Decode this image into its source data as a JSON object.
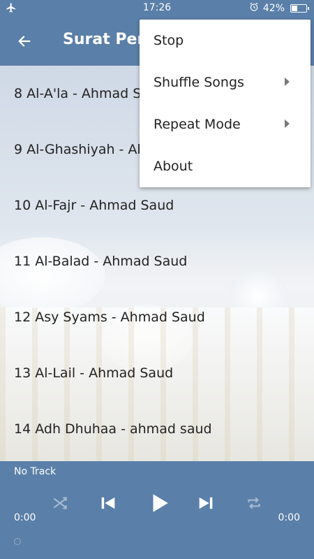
{
  "status_bar": {
    "time": "17:26",
    "battery": "42%",
    "battery_level": 0.42,
    "left_icon": "airplane-icon",
    "alarm_icon": "alarm-clock-icon"
  },
  "toolbar": {
    "title": "Surat Pend",
    "back_icon": "arrow-left-icon"
  },
  "tracks": [
    "8 Al-A'la - Ahmad Sau",
    "9 Al-Ghashiyah - Ahm",
    "10 Al-Fajr - Ahmad Saud",
    "11 Al-Balad - Ahmad Saud",
    "12 Asy Syams - Ahmad Saud",
    "13 Al-Lail - Ahmad Saud",
    "14 Adh Dhuhaa - ahmad saud"
  ],
  "player": {
    "track": "No Track",
    "elapsed": "0:00",
    "duration": "0:00",
    "icons": [
      "shuffle-icon",
      "skip-previous-icon",
      "play-icon",
      "skip-next-icon",
      "repeat-icon"
    ]
  },
  "menu": {
    "items": [
      {
        "label": "Stop",
        "submenu": false
      },
      {
        "label": "Shuffle Songs",
        "submenu": true
      },
      {
        "label": "Repeat Mode",
        "submenu": true
      },
      {
        "label": "About",
        "submenu": false
      }
    ]
  },
  "colors": {
    "primary": "#5a7fa8",
    "menu_bg": "#ffffff",
    "text": "#222222"
  }
}
